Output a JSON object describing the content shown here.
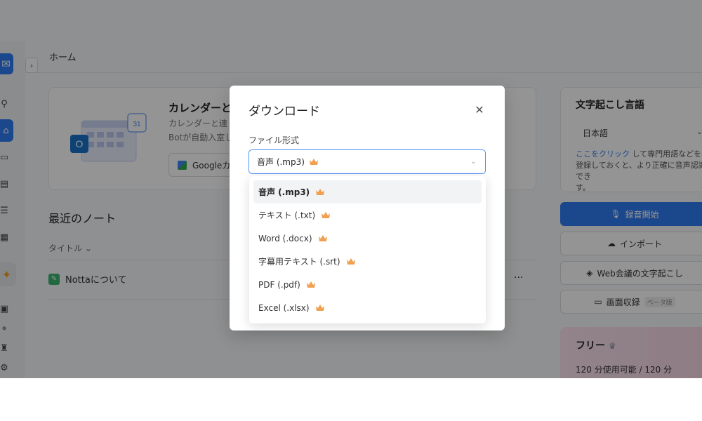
{
  "app": {
    "page_title": "ホーム",
    "calendar_card": {
      "title": "カレンダーと連",
      "desc_line1": "カレンダーと連",
      "desc_line2": "Botが自動入室し",
      "button_label": "Googleカ"
    },
    "recent_notes": {
      "title": "最近のノート",
      "column_title": "タイトル",
      "rows": [
        {
          "name": "Nottaについて"
        }
      ]
    },
    "transcription": {
      "title": "文字起こし言語",
      "language": "日本語",
      "hint_link": "ここをクリック",
      "hint_text": "して専門用語などを登録しておくと、より正確に音声認識でき",
      "hint_end": "す。"
    },
    "actions": {
      "record": "録音開始",
      "import": "インポート",
      "web_meeting": "Web会議の文字起こし",
      "screen_record": "画面収録",
      "beta": "ベータ版"
    },
    "plan": {
      "title": "フリー",
      "usage": "120 分使用可能 / 120 分"
    }
  },
  "modal": {
    "title": "ダウンロード",
    "field_label": "ファイル形式",
    "selected_value": "音声 (.mp3)",
    "options": [
      {
        "label": "音声 (.mp3)",
        "premium": true
      },
      {
        "label": "テキスト (.txt)",
        "premium": true
      },
      {
        "label": "Word (.docx)",
        "premium": true
      },
      {
        "label": "字幕用テキスト (.srt)",
        "premium": true
      },
      {
        "label": "PDF (.pdf)",
        "premium": true
      },
      {
        "label": "Excel (.xlsx)",
        "premium": true
      }
    ],
    "selected_index": 0
  },
  "colors": {
    "accent": "#2f7bf1",
    "crown": "#f0a050"
  },
  "icons": {
    "close": "close-icon",
    "chevron": "chevron-down-icon",
    "premium": "crown-icon"
  }
}
